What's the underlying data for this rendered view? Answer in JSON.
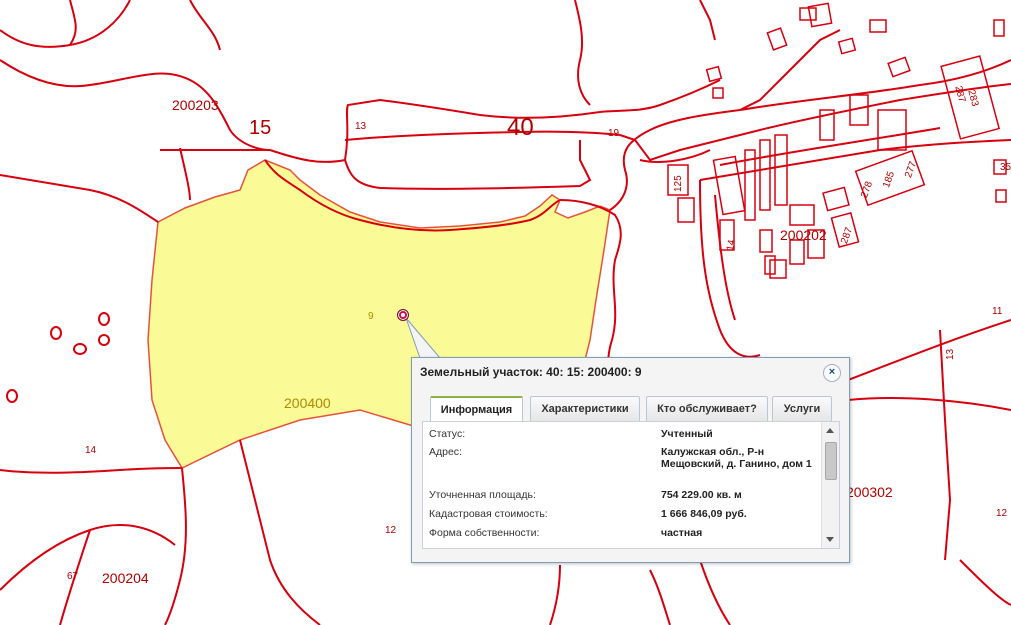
{
  "map": {
    "parcel_fill": "#fafa96",
    "line_color": "#d8000f",
    "labels": {
      "q200203": "200203",
      "q200202": "200202",
      "q200204": "200204",
      "q200400": "200400",
      "q200302": "200302",
      "n15": "15",
      "n40": "40",
      "n13a": "13",
      "n19": "19",
      "n9": "9",
      "n14a": "14",
      "n12a": "12",
      "n67": "67",
      "n11": "11",
      "n13b": "13",
      "n12b": "12",
      "n35": "35",
      "n125": "125",
      "n14b": "14",
      "n287a": "287",
      "n283": "283",
      "n278": "278",
      "n185": "185",
      "n277": "277",
      "n287b": "287"
    }
  },
  "popup": {
    "title": "Земельный участок: 40: 15: 200400: 9",
    "close_symbol": "×",
    "tabs": [
      "Информация",
      "Характеристики",
      "Кто обслуживает?",
      "Услуги"
    ],
    "active_tab": 0,
    "rows": [
      {
        "key": "Статус:",
        "value": "Учтенный"
      },
      {
        "key": "Адрес:",
        "value": "Калужская обл., Р-н Мещовский, д. Ганино, дом 1"
      },
      {
        "key": "Уточненная площадь:",
        "value": "754 229.00 кв. м"
      },
      {
        "key": "Кадастровая стоимость:",
        "value": "1 666 846,09 руб."
      },
      {
        "key": "Форма собственности:",
        "value": "частная"
      }
    ]
  }
}
